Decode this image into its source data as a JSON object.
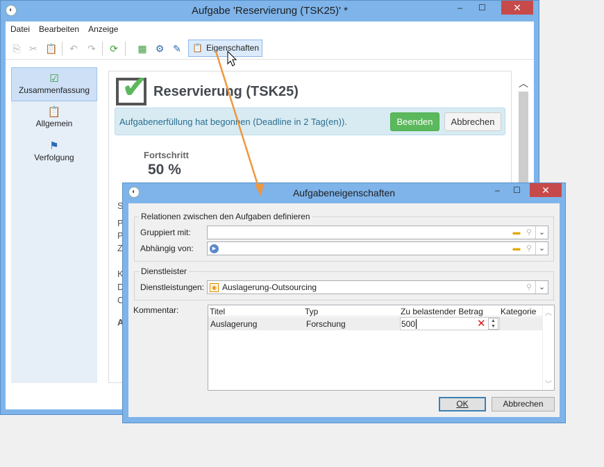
{
  "main_window": {
    "title": "Aufgabe 'Reservierung (TSK25)' *",
    "controls": {
      "minimize": "–",
      "maximize": "☐",
      "close": "✕"
    }
  },
  "menu": [
    "Datei",
    "Bearbeiten",
    "Anzeige"
  ],
  "toolbar": {
    "properties_label": "Eigenschaften",
    "icons": [
      "copy-icon",
      "cut-icon",
      "paste-icon",
      "undo-icon",
      "redo-icon",
      "refresh-icon",
      "calculator-icon",
      "settings-user-icon",
      "task-icon",
      "clipboard-icon"
    ]
  },
  "sidebar": {
    "items": [
      {
        "label": "Zusammenfassung",
        "icon": "check-clipboard-icon",
        "active": true
      },
      {
        "label": "Allgemein",
        "icon": "clipboard-icon",
        "active": false
      },
      {
        "label": "Verfolgung",
        "icon": "tracking-icon",
        "active": false
      }
    ]
  },
  "summary": {
    "task_title": "Reservierung (TSK25)",
    "status_message": "Aufgabenerfüllung hat begonnen (Deadline in 2 Tag(en)).",
    "finish_label": "Beenden",
    "cancel_label": "Abbrechen",
    "progress_label": "Fortschritt",
    "progress_value": "50 %",
    "partial_labels": [
      "S",
      "P",
      "P",
      "Z",
      "K",
      "D",
      "C",
      "A"
    ]
  },
  "dialog": {
    "title": "Aufgabeneigenschaften",
    "controls": {
      "minimize": "–",
      "maximize": "☐",
      "close": "✕"
    },
    "relations": {
      "legend": "Relationen zwischen den Aufgaben definieren",
      "grouped_label": "Gruppiert mit:",
      "grouped_value": "",
      "depends_label": "Abhängig von:",
      "depends_value": ""
    },
    "provider": {
      "legend": "Dienstleister",
      "services_label": "Dienstleistungen:",
      "services_value": "Auslagerung-Outsourcing"
    },
    "comment_label": "Kommentar:",
    "table": {
      "columns": [
        "Titel",
        "Typ",
        "Zu belastender Betrag",
        "Kategorie"
      ],
      "rows": [
        {
          "title": "Auslagerung",
          "type": "Forschung",
          "amount": "500",
          "category": ""
        }
      ]
    },
    "ok_label": "OK",
    "cancel_label": "Abbrechen"
  },
  "colors": {
    "window_frame": "#7eb4ea",
    "success_green": "#5cb85c",
    "info_bg": "#d8ebf3",
    "annotation_arrow": "#f0963c"
  }
}
